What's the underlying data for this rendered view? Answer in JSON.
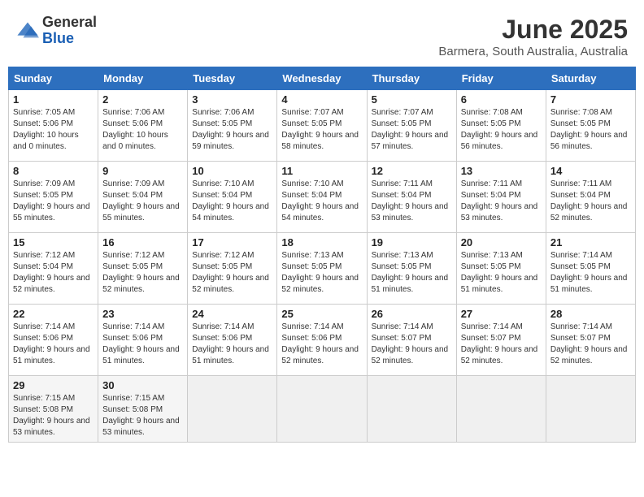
{
  "logo": {
    "general": "General",
    "blue": "Blue"
  },
  "header": {
    "month": "June 2025",
    "location": "Barmera, South Australia, Australia"
  },
  "weekdays": [
    "Sunday",
    "Monday",
    "Tuesday",
    "Wednesday",
    "Thursday",
    "Friday",
    "Saturday"
  ],
  "weeks": [
    [
      {
        "day": 1,
        "sunrise": "7:05 AM",
        "sunset": "5:06 PM",
        "daylight": "10 hours and 0 minutes."
      },
      {
        "day": 2,
        "sunrise": "7:06 AM",
        "sunset": "5:06 PM",
        "daylight": "10 hours and 0 minutes."
      },
      {
        "day": 3,
        "sunrise": "7:06 AM",
        "sunset": "5:05 PM",
        "daylight": "9 hours and 59 minutes."
      },
      {
        "day": 4,
        "sunrise": "7:07 AM",
        "sunset": "5:05 PM",
        "daylight": "9 hours and 58 minutes."
      },
      {
        "day": 5,
        "sunrise": "7:07 AM",
        "sunset": "5:05 PM",
        "daylight": "9 hours and 57 minutes."
      },
      {
        "day": 6,
        "sunrise": "7:08 AM",
        "sunset": "5:05 PM",
        "daylight": "9 hours and 56 minutes."
      },
      {
        "day": 7,
        "sunrise": "7:08 AM",
        "sunset": "5:05 PM",
        "daylight": "9 hours and 56 minutes."
      }
    ],
    [
      {
        "day": 8,
        "sunrise": "7:09 AM",
        "sunset": "5:05 PM",
        "daylight": "9 hours and 55 minutes."
      },
      {
        "day": 9,
        "sunrise": "7:09 AM",
        "sunset": "5:04 PM",
        "daylight": "9 hours and 55 minutes."
      },
      {
        "day": 10,
        "sunrise": "7:10 AM",
        "sunset": "5:04 PM",
        "daylight": "9 hours and 54 minutes."
      },
      {
        "day": 11,
        "sunrise": "7:10 AM",
        "sunset": "5:04 PM",
        "daylight": "9 hours and 54 minutes."
      },
      {
        "day": 12,
        "sunrise": "7:11 AM",
        "sunset": "5:04 PM",
        "daylight": "9 hours and 53 minutes."
      },
      {
        "day": 13,
        "sunrise": "7:11 AM",
        "sunset": "5:04 PM",
        "daylight": "9 hours and 53 minutes."
      },
      {
        "day": 14,
        "sunrise": "7:11 AM",
        "sunset": "5:04 PM",
        "daylight": "9 hours and 52 minutes."
      }
    ],
    [
      {
        "day": 15,
        "sunrise": "7:12 AM",
        "sunset": "5:04 PM",
        "daylight": "9 hours and 52 minutes."
      },
      {
        "day": 16,
        "sunrise": "7:12 AM",
        "sunset": "5:05 PM",
        "daylight": "9 hours and 52 minutes."
      },
      {
        "day": 17,
        "sunrise": "7:12 AM",
        "sunset": "5:05 PM",
        "daylight": "9 hours and 52 minutes."
      },
      {
        "day": 18,
        "sunrise": "7:13 AM",
        "sunset": "5:05 PM",
        "daylight": "9 hours and 52 minutes."
      },
      {
        "day": 19,
        "sunrise": "7:13 AM",
        "sunset": "5:05 PM",
        "daylight": "9 hours and 51 minutes."
      },
      {
        "day": 20,
        "sunrise": "7:13 AM",
        "sunset": "5:05 PM",
        "daylight": "9 hours and 51 minutes."
      },
      {
        "day": 21,
        "sunrise": "7:14 AM",
        "sunset": "5:05 PM",
        "daylight": "9 hours and 51 minutes."
      }
    ],
    [
      {
        "day": 22,
        "sunrise": "7:14 AM",
        "sunset": "5:06 PM",
        "daylight": "9 hours and 51 minutes."
      },
      {
        "day": 23,
        "sunrise": "7:14 AM",
        "sunset": "5:06 PM",
        "daylight": "9 hours and 51 minutes."
      },
      {
        "day": 24,
        "sunrise": "7:14 AM",
        "sunset": "5:06 PM",
        "daylight": "9 hours and 51 minutes."
      },
      {
        "day": 25,
        "sunrise": "7:14 AM",
        "sunset": "5:06 PM",
        "daylight": "9 hours and 52 minutes."
      },
      {
        "day": 26,
        "sunrise": "7:14 AM",
        "sunset": "5:07 PM",
        "daylight": "9 hours and 52 minutes."
      },
      {
        "day": 27,
        "sunrise": "7:14 AM",
        "sunset": "5:07 PM",
        "daylight": "9 hours and 52 minutes."
      },
      {
        "day": 28,
        "sunrise": "7:14 AM",
        "sunset": "5:07 PM",
        "daylight": "9 hours and 52 minutes."
      }
    ],
    [
      {
        "day": 29,
        "sunrise": "7:15 AM",
        "sunset": "5:08 PM",
        "daylight": "9 hours and 53 minutes."
      },
      {
        "day": 30,
        "sunrise": "7:15 AM",
        "sunset": "5:08 PM",
        "daylight": "9 hours and 53 minutes."
      },
      null,
      null,
      null,
      null,
      null
    ]
  ],
  "labels": {
    "sunrise": "Sunrise:",
    "sunset": "Sunset:",
    "daylight": "Daylight:"
  }
}
